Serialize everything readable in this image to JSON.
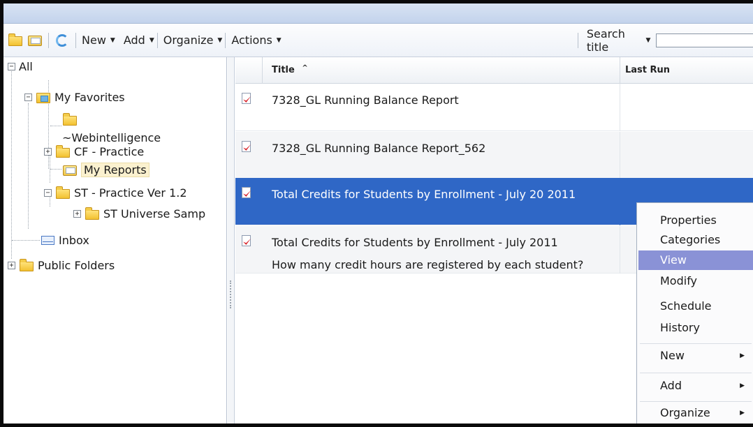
{
  "toolbar": {
    "menus": [
      {
        "label": "New"
      },
      {
        "label": "Add"
      },
      {
        "label": "Organize"
      },
      {
        "label": "Actions"
      }
    ],
    "search_label": "Search title",
    "search_value": ""
  },
  "tree": {
    "root": "All",
    "my_favorites": "My Favorites",
    "webintelligence": "~Webintelligence",
    "cf_practice": "CF - Practice",
    "my_reports": "My Reports",
    "st_practice": "ST - Practice Ver 1.2",
    "st_universe": "ST Universe Samp",
    "inbox": "Inbox",
    "public_folders": "Public Folders"
  },
  "list": {
    "columns": {
      "title": "Title",
      "last_run": "Last Run"
    },
    "sort_indicator": "^",
    "rows": [
      {
        "title": "7328_GL Running Balance Report",
        "description": ""
      },
      {
        "title": "7328_GL Running Balance Report_562",
        "description": ""
      },
      {
        "title": "Total Credits for Students by Enrollment - July 20 2011",
        "description": "",
        "selected": true
      },
      {
        "title": "Total Credits for Students by Enrollment - July 2011",
        "description": "How many credit hours are registered by each student?"
      }
    ]
  },
  "context_menu": {
    "items": [
      "Properties",
      "Categories",
      "View",
      "Modify",
      "Schedule",
      "History"
    ],
    "highlighted": "View",
    "submenus": [
      "New",
      "Add",
      "Organize"
    ]
  },
  "colors": {
    "selection": "#2f67c6",
    "menu_highlight": "#8a92d6",
    "titlebar": "#c3d3ec"
  }
}
